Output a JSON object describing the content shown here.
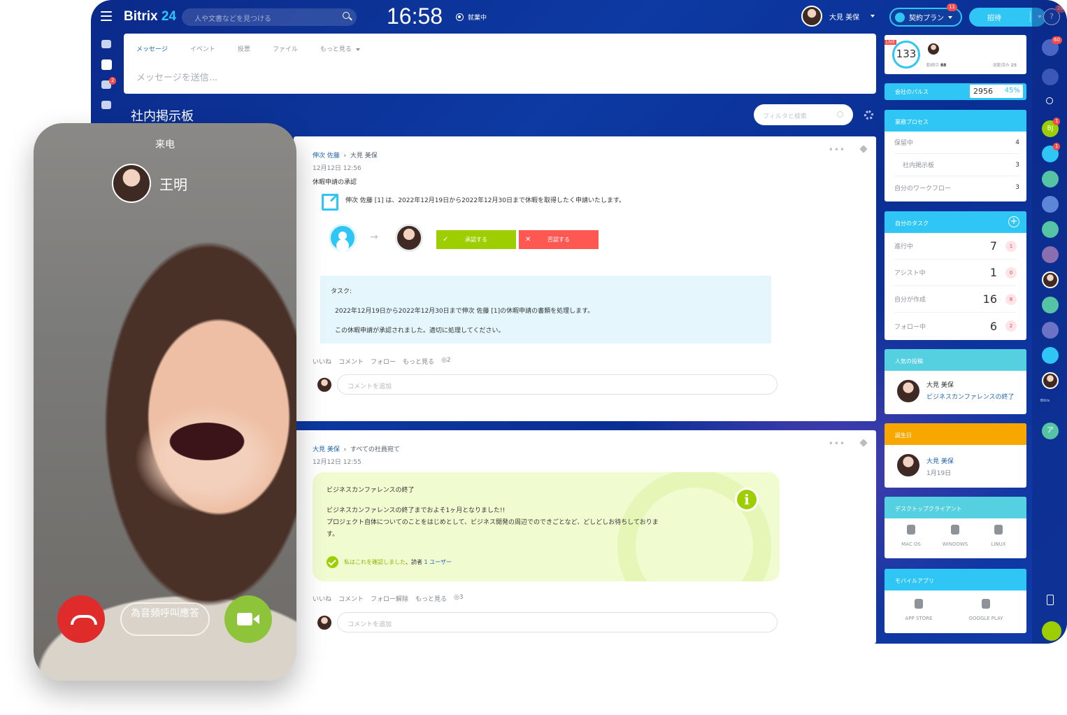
{
  "header": {
    "logo_main": "Bitrix",
    "logo_accent": "24",
    "search_placeholder": "人や文書などを見つける",
    "clock": "16:58",
    "work_status": "就業中",
    "user_name": "大見 美保",
    "plan_label": "契約プラン",
    "plan_badge": "11",
    "invite_label": "招待",
    "help_badge": "28"
  },
  "left_nav": {
    "chat_badge": "2"
  },
  "composer": {
    "tabs": [
      "メッセージ",
      "イベント",
      "投票",
      "ファイル",
      "もっと見る"
    ],
    "placeholder": "メッセージを送信..."
  },
  "feed": {
    "title": "社内掲示板",
    "filter_placeholder": "フィルタと検索"
  },
  "post1": {
    "author": "伸次 佐藤",
    "recipient": "大見 美保",
    "date": "12月12日 12:56",
    "title": "休暇申請の承認",
    "body": "伸次 佐藤 [1] は、2022年12月19日から2022年12月30日まで休暇を取得したく申請いたします。",
    "approve": "承認する",
    "reject": "否認する",
    "task_label": "タスク:",
    "task_line1": "2022年12月19日から2022年12月30日まで伸次 佐藤 [1]の休暇申請の書類を処理します。",
    "task_line2": "この休暇申請が承認されました。適切に処理してください。",
    "actions": [
      "いいね",
      "コメント",
      "フォロー",
      "もっと見る"
    ],
    "views": "2",
    "comment_placeholder": "コメントを追加"
  },
  "post2": {
    "author": "大見 美保",
    "recipient": "すべての社員宛て",
    "date": "12月12日 12:55",
    "title": "ビジネスカンファレンスの終了",
    "line1": "ビジネスカンファレンスの終了までおよそ1ヶ月となりました!!",
    "line2": "プロジェクト自体についてのことをはじめとして、ビジネス開発の周辺でのできごとなど、どしどしお待ちしておりま",
    "line3": "す。",
    "confirm": "私はこれを確認しました",
    "readers_prefix": "、読者",
    "readers_link": "1 ユーザー",
    "actions": [
      "いいね",
      "コメント",
      "フォロー解除",
      "もっと見る"
    ],
    "views": "3",
    "comment_placeholder": "コメントを追加"
  },
  "right": {
    "live": "LIVE",
    "count": "133",
    "working_label": "勤務中",
    "working": "88",
    "done_label": "退勤済み",
    "done": "25",
    "pulse_label": "会社のパルス",
    "pulse_value": "2956",
    "pulse_pct": "45%",
    "process_title": "業務プロセス",
    "process_rows": [
      {
        "label": "保留中",
        "value": "4"
      },
      {
        "label": "社内掲示板",
        "value": "3"
      },
      {
        "label": "自分のワークフロー",
        "value": "3"
      }
    ],
    "tasks_title": "自分のタスク",
    "tasks": [
      {
        "label": "進行中",
        "n": "7",
        "c": "1"
      },
      {
        "label": "アシスト中",
        "n": "1",
        "c": "0"
      },
      {
        "label": "自分が作成",
        "n": "16",
        "c": "8"
      },
      {
        "label": "フォロー中",
        "n": "6",
        "c": "2"
      }
    ],
    "popular_title": "人気の投稿",
    "popular_name": "大見 美保",
    "popular_post": "ビジネスカンファレンスの終了",
    "birthday_title": "誕生日",
    "birthday_name": "大見 美保",
    "birthday_date": "1月19日",
    "desktop_title": "デスクトップクライアント",
    "desktop": [
      "MAC OS",
      "WINDOWS",
      "LINUX"
    ],
    "mobile_title": "モバイルアプリ",
    "mobile": [
      "APP STORE",
      "GOOGLE PLAY"
    ]
  },
  "right_nav": {
    "bell_badge": "60",
    "initials": "BJ",
    "bj_badge": "1",
    "chat_badge": "1",
    "brand": "Bitrix",
    "item": "ア"
  },
  "call": {
    "header": "来电",
    "caller": "王明",
    "audio_label": "為音頻呼叫應答"
  },
  "colors": {
    "accent": "#2fc6f6",
    "approve": "#9dcf00",
    "reject": "#ff5752",
    "birthday": "#f7a700",
    "hangup": "#e02b2b",
    "video": "#8ec43a"
  }
}
